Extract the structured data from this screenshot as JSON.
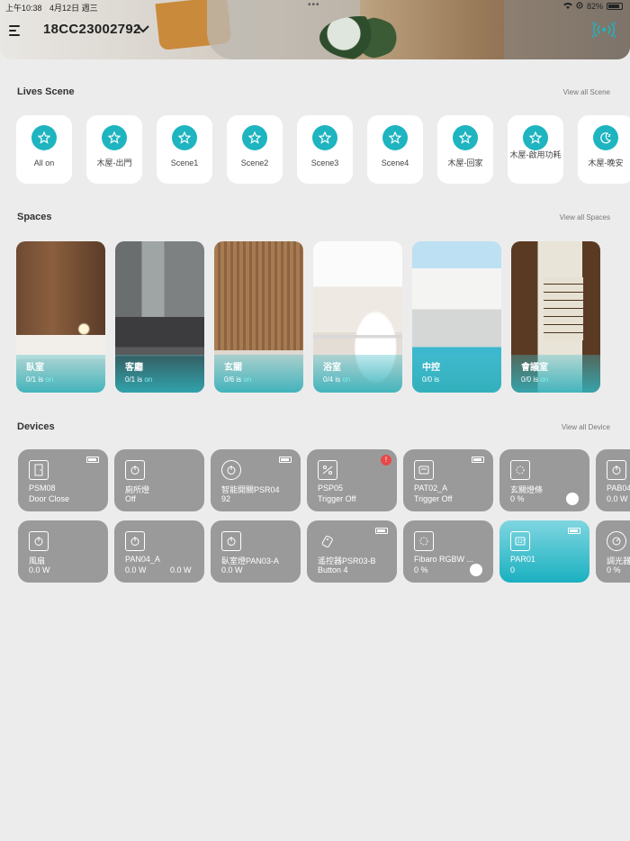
{
  "status": {
    "time": "上午10:38",
    "date": "4月12日 週三",
    "battery": "82%"
  },
  "header": {
    "device_id": "18CC23002792"
  },
  "lives_scene": {
    "title": "Lives Scene",
    "link": "View all Scene",
    "items": [
      {
        "label": "All on",
        "icon": "star-icon"
      },
      {
        "label": "木屋-出門",
        "icon": "star-icon"
      },
      {
        "label": "Scene1",
        "icon": "star-icon"
      },
      {
        "label": "Scene2",
        "icon": "star-icon"
      },
      {
        "label": "Scene3",
        "icon": "star-icon"
      },
      {
        "label": "Scene4",
        "icon": "star-icon"
      },
      {
        "label": "木屋-回家",
        "icon": "star-icon"
      },
      {
        "label": "木屋-啟用功耗",
        "icon": "star-icon"
      },
      {
        "label": "木屋-晚安",
        "icon": "moon-icon"
      }
    ]
  },
  "spaces": {
    "title": "Spaces",
    "link": "View all Spaces",
    "items": [
      {
        "name": "臥室",
        "count": "0/1 is",
        "state": "on"
      },
      {
        "name": "客廳",
        "count": "0/1 is",
        "state": "on"
      },
      {
        "name": "玄關",
        "count": "0/6 is",
        "state": "on"
      },
      {
        "name": "浴室",
        "count": "0/4 is",
        "state": "on"
      },
      {
        "name": "中控",
        "count": "0/0 is",
        "state": ""
      },
      {
        "name": "會議室",
        "count": "0/0 is",
        "state": "on"
      }
    ]
  },
  "devices": {
    "title": "Devices",
    "link": "View all Device",
    "row1": [
      {
        "name": "PSM08",
        "value": "Door Close",
        "icon": "door-icon",
        "battery": true
      },
      {
        "name": "廁所燈",
        "value": "Off",
        "icon": "power-icon"
      },
      {
        "name": "智能開關PSR04",
        "value": "92",
        "icon": "power-icon",
        "battery": true
      },
      {
        "name": "PSP05",
        "value": "Trigger Off",
        "icon": "switch-icon",
        "alert": true
      },
      {
        "name": "PAT02_A",
        "value": "Trigger Off",
        "icon": "sensor-icon",
        "battery": true
      },
      {
        "name": "玄關燈條",
        "value": "0 %",
        "icon": "dimmer-icon",
        "toggle": true
      },
      {
        "name": "PAB04",
        "value": "0.0 W",
        "icon": "power-icon"
      }
    ],
    "row2": [
      {
        "name": "風扇",
        "value": "0.0 W",
        "icon": "power-icon"
      },
      {
        "name": "PAN04_A",
        "value": "0.0 W",
        "value2": "0.0 W",
        "icon": "power-icon"
      },
      {
        "name": "臥室燈PAN03-A",
        "value": "0.0 W",
        "icon": "power-icon"
      },
      {
        "name": "遙控器PSR03-B",
        "value": "Button 4",
        "icon": "remote-icon",
        "battery": true
      },
      {
        "name": "Fibaro RGBW ...",
        "value": "0 %",
        "icon": "dimmer-icon",
        "toggle": true
      },
      {
        "name": "PAR01",
        "value": "0",
        "icon": "thermostat-icon",
        "battery": true,
        "active": true
      },
      {
        "name": "調光器",
        "value": "0 %",
        "icon": "knob-icon"
      }
    ]
  }
}
